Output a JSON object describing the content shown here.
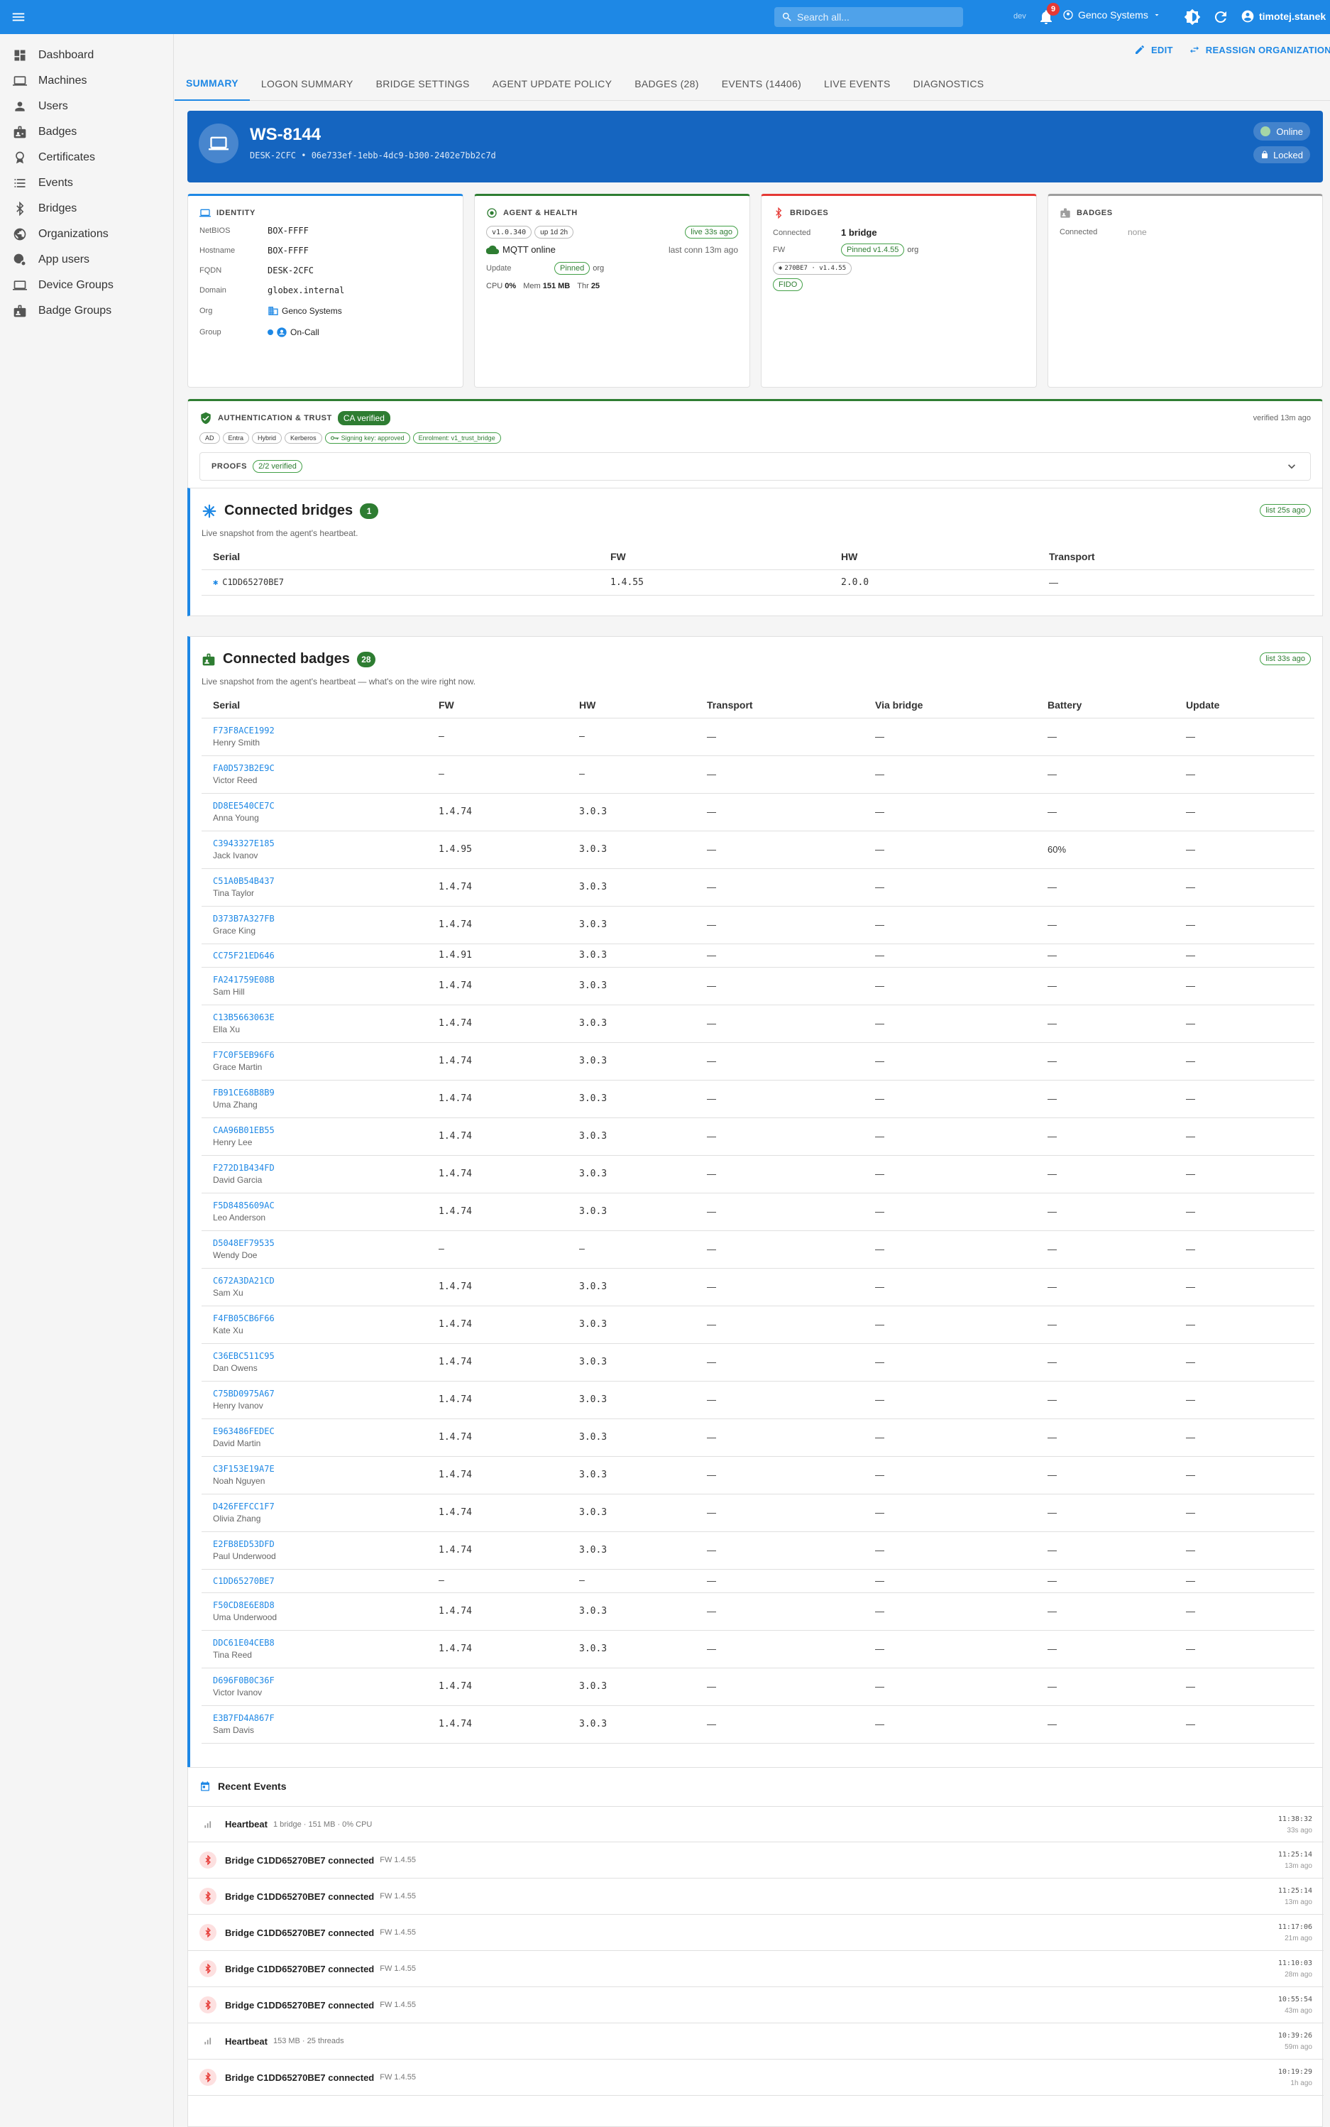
{
  "topbar": {
    "search_placeholder": "Search all...",
    "env": "dev",
    "notifications": "9",
    "org": "Genco Systems",
    "user": "timotej.stanek"
  },
  "sidebar": {
    "items": [
      {
        "label": "Dashboard",
        "icon": "dashboard-icon"
      },
      {
        "label": "Machines",
        "icon": "laptop-icon"
      },
      {
        "label": "Users",
        "icon": "person-icon"
      },
      {
        "label": "Badges",
        "icon": "badge-icon"
      },
      {
        "label": "Certificates",
        "icon": "certificate-icon"
      },
      {
        "label": "Events",
        "icon": "list-icon"
      },
      {
        "label": "Bridges",
        "icon": "bluetooth-icon"
      },
      {
        "label": "Organizations",
        "icon": "organization-icon"
      },
      {
        "label": "App users",
        "icon": "app-users-icon"
      },
      {
        "label": "Device Groups",
        "icon": "device-group-icon"
      },
      {
        "label": "Badge Groups",
        "icon": "badge-group-icon"
      }
    ]
  },
  "actions": {
    "edit": "EDIT",
    "reassign": "REASSIGN ORGANIZATION"
  },
  "tabs": [
    "SUMMARY",
    "LOGON SUMMARY",
    "BRIDGE SETTINGS",
    "AGENT UPDATE POLICY",
    "BADGES (28)",
    "EVENTS (14406)",
    "LIVE EVENTS",
    "DIAGNOSTICS"
  ],
  "header": {
    "title": "WS-8144",
    "subtitle": "DESK-2CFC  •  06e733ef-1ebb-4dc9-b300-2402e7bb2c7d",
    "status": "Online",
    "lock": "Locked"
  },
  "identity": {
    "title": "IDENTITY",
    "netbios_label": "NetBIOS",
    "netbios": "BOX-FFFF",
    "hostname_label": "Hostname",
    "hostname": "BOX-FFFF",
    "fqdn_label": "FQDN",
    "fqdn": "DESK-2CFC",
    "domain_label": "Domain",
    "domain": "globex.internal",
    "org_label": "Org",
    "org": "Genco Systems",
    "group_label": "Group",
    "group": "On-Call"
  },
  "agent": {
    "title": "AGENT & HEALTH",
    "version": "v1.0.340",
    "uptime": "up 1d 2h",
    "live": "live 33s ago",
    "mqtt": "MQTT online",
    "last_conn": "last conn 13m ago",
    "update_label": "Update",
    "update_pill": "Pinned",
    "update_scope": "org",
    "cpu_label": "CPU",
    "cpu": "0%",
    "mem_label": "Mem",
    "mem": "151 MB",
    "thr_label": "Thr",
    "thr": "25"
  },
  "bridges_card": {
    "title": "BRIDGES",
    "connected_label": "Connected",
    "connected": "1 bridge",
    "fw_label": "FW",
    "fw_pill": "Pinned v1.4.55",
    "fw_scope": "org",
    "bridge_chip": "270BE7 · v1.4.55",
    "fido": "FIDO"
  },
  "badges_card": {
    "title": "BADGES",
    "connected_label": "Connected",
    "connected": "none"
  },
  "auth": {
    "title": "AUTHENTICATION & TRUST",
    "ca": "CA verified",
    "verified": "verified 13m ago",
    "chips": [
      "AD",
      "Entra",
      "Hybrid",
      "Kerberos"
    ],
    "signing": "Signing key: approved",
    "enrolment": "Enrolment: v1_trust_bridge",
    "proofs_label": "PROOFS",
    "proofs": "2/2 verified"
  },
  "connected_bridges": {
    "title": "Connected bridges",
    "count": "1",
    "subtitle": "Live snapshot from the agent's heartbeat.",
    "list_ago": "list 25s ago",
    "columns": [
      "Serial",
      "FW",
      "HW",
      "Transport"
    ],
    "rows": [
      {
        "serial": "C1DD65270BE7",
        "fw": "1.4.55",
        "hw": "2.0.0",
        "transport": "—"
      }
    ]
  },
  "connected_badges": {
    "title": "Connected badges",
    "count": "28",
    "subtitle": "Live snapshot from the agent's heartbeat — what's on the wire right now.",
    "list_ago": "list 33s ago",
    "columns": [
      "Serial",
      "FW",
      "HW",
      "Transport",
      "Via bridge",
      "Battery",
      "Update"
    ],
    "rows": [
      {
        "serial": "F73F8ACE1992",
        "owner": "Henry Smith",
        "fw": "—",
        "hw": "—",
        "transport": "—",
        "via": "—",
        "battery": "—",
        "update": "—"
      },
      {
        "serial": "FA0D573B2E9C",
        "owner": "Victor Reed",
        "fw": "—",
        "hw": "—",
        "transport": "—",
        "via": "—",
        "battery": "—",
        "update": "—"
      },
      {
        "serial": "DD8EE540CE7C",
        "owner": "Anna Young",
        "fw": "1.4.74",
        "hw": "3.0.3",
        "transport": "—",
        "via": "—",
        "battery": "—",
        "update": "—"
      },
      {
        "serial": "C3943327E185",
        "owner": "Jack Ivanov",
        "fw": "1.4.95",
        "hw": "3.0.3",
        "transport": "—",
        "via": "—",
        "battery": "60%",
        "update": "—"
      },
      {
        "serial": "C51A0B54B437",
        "owner": "Tina Taylor",
        "fw": "1.4.74",
        "hw": "3.0.3",
        "transport": "—",
        "via": "—",
        "battery": "—",
        "update": "—"
      },
      {
        "serial": "D373B7A327FB",
        "owner": "Grace King",
        "fw": "1.4.74",
        "hw": "3.0.3",
        "transport": "—",
        "via": "—",
        "battery": "—",
        "update": "—"
      },
      {
        "serial": "CC75F21ED646",
        "owner": "",
        "fw": "1.4.91",
        "hw": "3.0.3",
        "transport": "—",
        "via": "—",
        "battery": "—",
        "update": "—"
      },
      {
        "serial": "FA241759E08B",
        "owner": "Sam Hill",
        "fw": "1.4.74",
        "hw": "3.0.3",
        "transport": "—",
        "via": "—",
        "battery": "—",
        "update": "—"
      },
      {
        "serial": "C13B5663063E",
        "owner": "Ella Xu",
        "fw": "1.4.74",
        "hw": "3.0.3",
        "transport": "—",
        "via": "—",
        "battery": "—",
        "update": "—"
      },
      {
        "serial": "F7C0F5EB96F6",
        "owner": "Grace Martin",
        "fw": "1.4.74",
        "hw": "3.0.3",
        "transport": "—",
        "via": "—",
        "battery": "—",
        "update": "—"
      },
      {
        "serial": "FB91CE68B8B9",
        "owner": "Uma Zhang",
        "fw": "1.4.74",
        "hw": "3.0.3",
        "transport": "—",
        "via": "—",
        "battery": "—",
        "update": "—"
      },
      {
        "serial": "CAA96B01EB55",
        "owner": "Henry Lee",
        "fw": "1.4.74",
        "hw": "3.0.3",
        "transport": "—",
        "via": "—",
        "battery": "—",
        "update": "—"
      },
      {
        "serial": "F272D1B434FD",
        "owner": "David Garcia",
        "fw": "1.4.74",
        "hw": "3.0.3",
        "transport": "—",
        "via": "—",
        "battery": "—",
        "update": "—"
      },
      {
        "serial": "F5D8485609AC",
        "owner": "Leo Anderson",
        "fw": "1.4.74",
        "hw": "3.0.3",
        "transport": "—",
        "via": "—",
        "battery": "—",
        "update": "—"
      },
      {
        "serial": "D5048EF79535",
        "owner": "Wendy Doe",
        "fw": "—",
        "hw": "—",
        "transport": "—",
        "via": "—",
        "battery": "—",
        "update": "—"
      },
      {
        "serial": "C672A3DA21CD",
        "owner": "Sam Xu",
        "fw": "1.4.74",
        "hw": "3.0.3",
        "transport": "—",
        "via": "—",
        "battery": "—",
        "update": "—"
      },
      {
        "serial": "F4FB05CB6F66",
        "owner": "Kate Xu",
        "fw": "1.4.74",
        "hw": "3.0.3",
        "transport": "—",
        "via": "—",
        "battery": "—",
        "update": "—"
      },
      {
        "serial": "C36EBC511C95",
        "owner": "Dan Owens",
        "fw": "1.4.74",
        "hw": "3.0.3",
        "transport": "—",
        "via": "—",
        "battery": "—",
        "update": "—"
      },
      {
        "serial": "C75BD0975A67",
        "owner": "Henry Ivanov",
        "fw": "1.4.74",
        "hw": "3.0.3",
        "transport": "—",
        "via": "—",
        "battery": "—",
        "update": "—"
      },
      {
        "serial": "E963486FEDEC",
        "owner": "David Martin",
        "fw": "1.4.74",
        "hw": "3.0.3",
        "transport": "—",
        "via": "—",
        "battery": "—",
        "update": "—"
      },
      {
        "serial": "C3F153E19A7E",
        "owner": "Noah Nguyen",
        "fw": "1.4.74",
        "hw": "3.0.3",
        "transport": "—",
        "via": "—",
        "battery": "—",
        "update": "—"
      },
      {
        "serial": "D426FEFCC1F7",
        "owner": "Olivia Zhang",
        "fw": "1.4.74",
        "hw": "3.0.3",
        "transport": "—",
        "via": "—",
        "battery": "—",
        "update": "—"
      },
      {
        "serial": "E2FB8ED53DFD",
        "owner": "Paul Underwood",
        "fw": "1.4.74",
        "hw": "3.0.3",
        "transport": "—",
        "via": "—",
        "battery": "—",
        "update": "—"
      },
      {
        "serial": "C1DD65270BE7",
        "owner": "",
        "fw": "—",
        "hw": "—",
        "transport": "—",
        "via": "—",
        "battery": "—",
        "update": "—"
      },
      {
        "serial": "F50CD8E6E8D8",
        "owner": "Uma Underwood",
        "fw": "1.4.74",
        "hw": "3.0.3",
        "transport": "—",
        "via": "—",
        "battery": "—",
        "update": "—"
      },
      {
        "serial": "DDC61E04CEB8",
        "owner": "Tina Reed",
        "fw": "1.4.74",
        "hw": "3.0.3",
        "transport": "—",
        "via": "—",
        "battery": "—",
        "update": "—"
      },
      {
        "serial": "D696F0B0C36F",
        "owner": "Victor Ivanov",
        "fw": "1.4.74",
        "hw": "3.0.3",
        "transport": "—",
        "via": "—",
        "battery": "—",
        "update": "—"
      },
      {
        "serial": "E3B7FD4A867F",
        "owner": "Sam Davis",
        "fw": "1.4.74",
        "hw": "3.0.3",
        "transport": "—",
        "via": "—",
        "battery": "—",
        "update": "—"
      }
    ]
  },
  "events": {
    "title": "Recent Events",
    "items": [
      {
        "kind": "heartbeat",
        "text": "Heartbeat",
        "detail": "1 bridge · 151 MB · 0% CPU",
        "time": "11:38:32",
        "ago": "33s ago"
      },
      {
        "kind": "bridge",
        "text": "Bridge C1DD65270BE7 connected",
        "detail": "FW 1.4.55",
        "time": "11:25:14",
        "ago": "13m ago"
      },
      {
        "kind": "bridge",
        "text": "Bridge C1DD65270BE7 connected",
        "detail": "FW 1.4.55",
        "time": "11:25:14",
        "ago": "13m ago"
      },
      {
        "kind": "bridge",
        "text": "Bridge C1DD65270BE7 connected",
        "detail": "FW 1.4.55",
        "time": "11:17:06",
        "ago": "21m ago"
      },
      {
        "kind": "bridge",
        "text": "Bridge C1DD65270BE7 connected",
        "detail": "FW 1.4.55",
        "time": "11:10:03",
        "ago": "28m ago"
      },
      {
        "kind": "bridge",
        "text": "Bridge C1DD65270BE7 connected",
        "detail": "FW 1.4.55",
        "time": "10:55:54",
        "ago": "43m ago"
      },
      {
        "kind": "heartbeat",
        "text": "Heartbeat",
        "detail": "153 MB · 25 threads",
        "time": "10:39:26",
        "ago": "59m ago"
      },
      {
        "kind": "bridge",
        "text": "Bridge C1DD65270BE7 connected",
        "detail": "FW 1.4.55",
        "time": "10:19:29",
        "ago": "1h ago"
      }
    ]
  }
}
